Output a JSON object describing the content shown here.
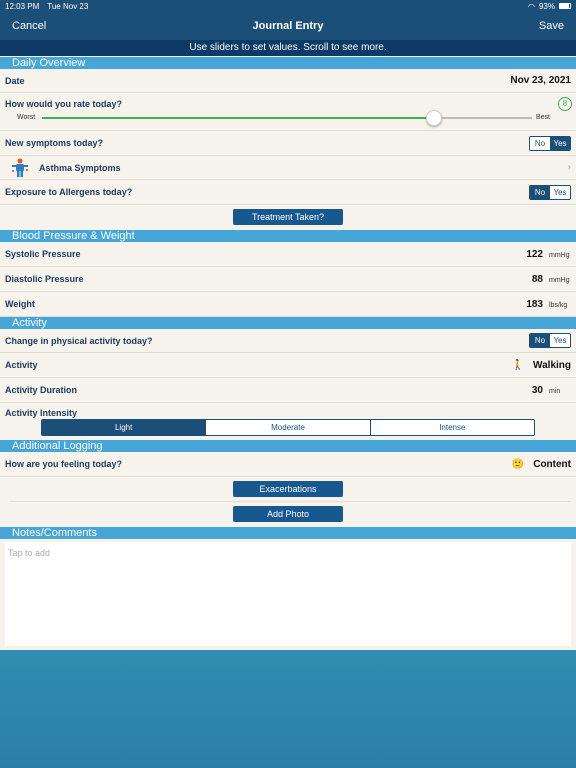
{
  "status": {
    "time": "12:03 PM",
    "date": "Tue Nov 23",
    "battery": "93%"
  },
  "nav": {
    "cancel": "Cancel",
    "title": "Journal Entry",
    "save": "Save"
  },
  "hint": "Use sliders to set values. Scroll to see more.",
  "sections": {
    "daily": "Daily Overview",
    "bp": "Blood Pressure & Weight",
    "activity": "Activity",
    "logging": "Additional Logging",
    "notes": "Notes/Comments"
  },
  "daily": {
    "date_label": "Date",
    "date_value": "Nov 23, 2021",
    "rate_label": "How would you rate today?",
    "rating": "8",
    "rating_fraction": 0.8,
    "worst": "Worst",
    "best": "Best",
    "symptoms_label": "New symptoms today?",
    "asthma_label": "Asthma Symptoms",
    "allergens_label": "Exposure to Allergens today?",
    "treatment_button": "Treatment Taken?"
  },
  "toggle": {
    "no": "No",
    "yes": "Yes"
  },
  "bp": {
    "systolic_label": "Systolic Pressure",
    "systolic": "122",
    "systolic_unit": "mmHg",
    "diastolic_label": "Diastolic Pressure",
    "diastolic": "88",
    "diastolic_unit": "mmHg",
    "weight_label": "Weight",
    "weight": "183",
    "weight_unit": "lbs/kg"
  },
  "activity": {
    "change_label": "Change in physical activity today?",
    "activity_label": "Activity",
    "activity_value": "Walking",
    "duration_label": "Activity Duration",
    "duration": "30",
    "duration_unit": "min",
    "intensity_label": "Activity Intensity",
    "intensity_options": [
      "Light",
      "Moderate",
      "Intense"
    ]
  },
  "logging": {
    "feeling_label": "How are you feeling today?",
    "feeling_value": "Content",
    "exacerbations_button": "Exacerbations",
    "photo_button": "Add Photo"
  },
  "notes": {
    "placeholder": "Tap to add"
  },
  "colors": {
    "nav": "#1b4f78",
    "section": "#47a6d8",
    "accent_green": "#3fae5b"
  }
}
